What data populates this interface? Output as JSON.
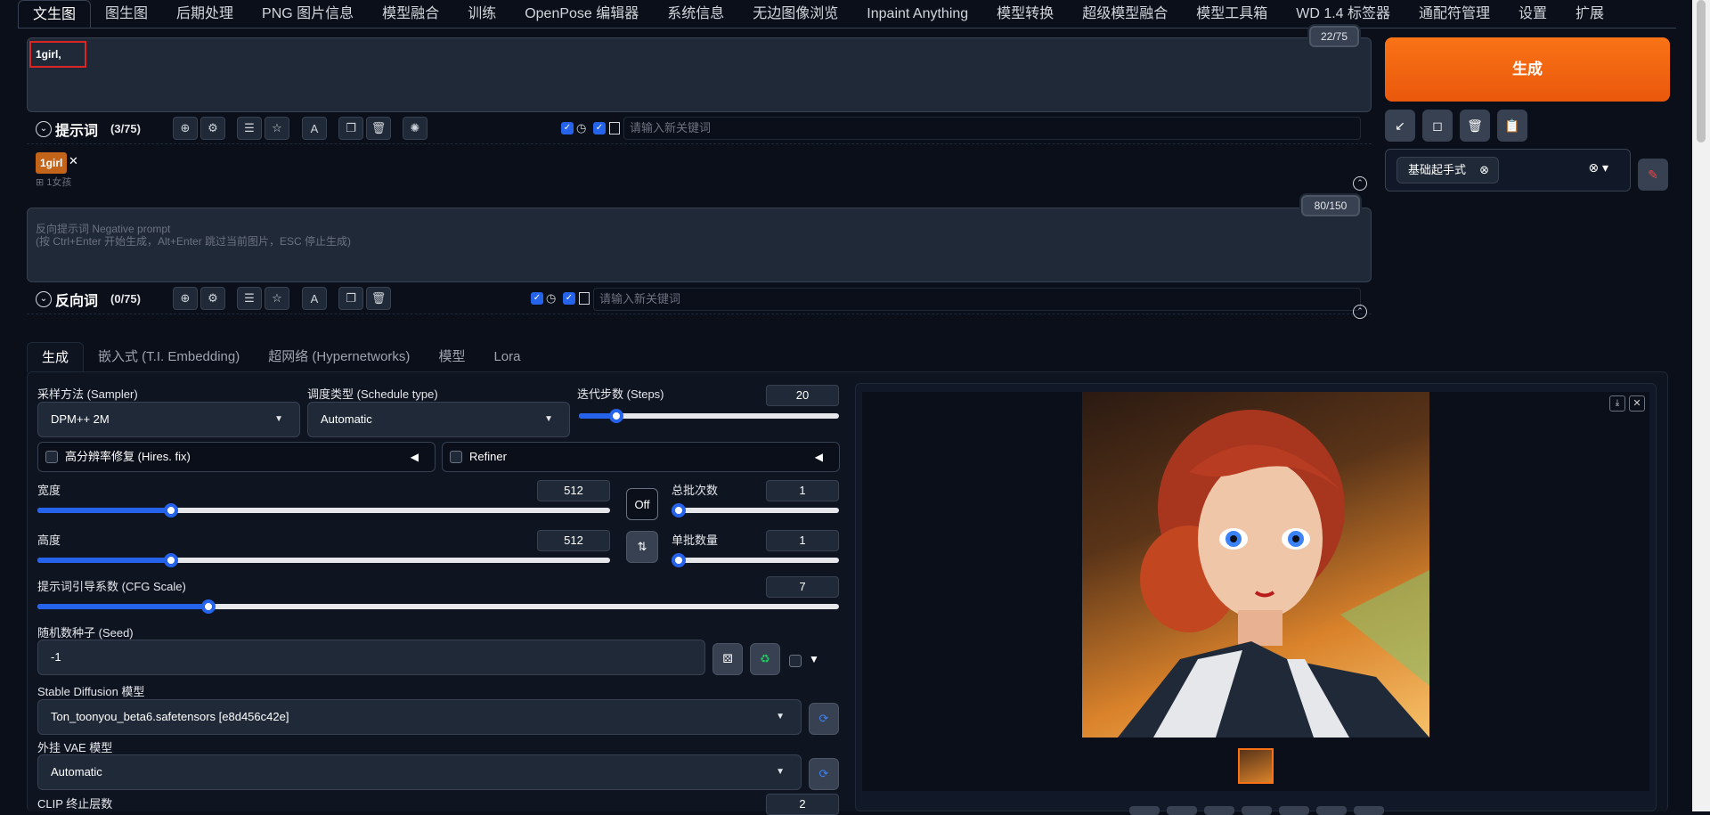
{
  "top_tabs": [
    "文生图",
    "图生图",
    "后期处理",
    "PNG 图片信息",
    "模型融合",
    "训练",
    "OpenPose 编辑器",
    "系统信息",
    "无边图像浏览",
    "Inpaint Anything",
    "模型转换",
    "超级模型融合",
    "模型工具箱",
    "WD 1.4 标签器",
    "通配符管理",
    "设置",
    "扩展"
  ],
  "prompt": {
    "value": "1girl,",
    "token_count": "22/75",
    "title": "提示词",
    "count": "(3/75)",
    "keyword_placeholder": "请输入新关键词",
    "tag": "1girl",
    "tag_translation": "1女孩"
  },
  "negative": {
    "placeholder_line1": "反向提示词 Negative prompt",
    "placeholder_line2": "(按 Ctrl+Enter 开始生成，Alt+Enter 跳过当前图片，ESC 停止生成)",
    "token_count": "80/150",
    "title": "反向词",
    "count": "(0/75)",
    "keyword_placeholder": "请输入新关键词"
  },
  "generate_label": "生成",
  "style": {
    "selected": "基础起手式"
  },
  "sub_tabs": [
    "生成",
    "嵌入式 (T.I. Embedding)",
    "超网络 (Hypernetworks)",
    "模型",
    "Lora"
  ],
  "params": {
    "sampler_label": "采样方法 (Sampler)",
    "sampler_value": "DPM++ 2M",
    "schedule_label": "调度类型 (Schedule type)",
    "schedule_value": "Automatic",
    "steps_label": "迭代步数 (Steps)",
    "steps_value": "20",
    "hires_label": "高分辨率修复 (Hires. fix)",
    "refiner_label": "Refiner",
    "width_label": "宽度",
    "width_value": "512",
    "height_label": "高度",
    "height_value": "512",
    "batch_count_label": "总批次数",
    "batch_count_value": "1",
    "batch_size_label": "单批数量",
    "batch_size_value": "1",
    "off_label": "Off",
    "cfg_label": "提示词引导系数 (CFG Scale)",
    "cfg_value": "7",
    "seed_label": "随机数种子 (Seed)",
    "seed_value": "-1",
    "model_label": "Stable Diffusion 模型",
    "model_value": "Ton_toonyou_beta6.safetensors [e8d456c42e]",
    "vae_label": "外挂 VAE 模型",
    "vae_value": "Automatic",
    "clip_label": "CLIP 终止层数",
    "clip_value": "2"
  },
  "colors": {
    "accent": "#2563eb",
    "generate": "#f97316",
    "background": "#0b0f19"
  }
}
